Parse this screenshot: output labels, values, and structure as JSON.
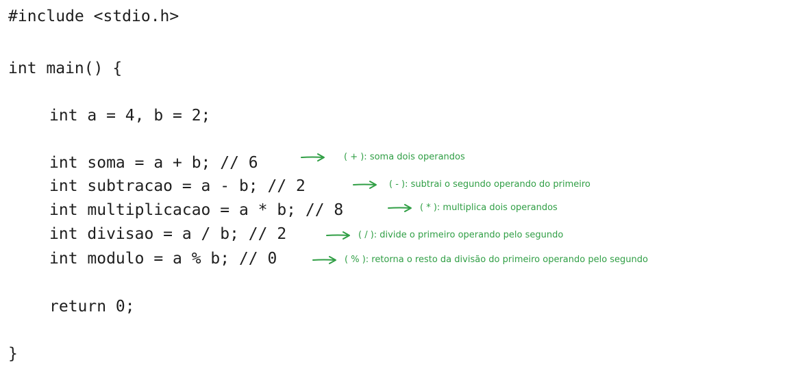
{
  "code": {
    "include": "#include <stdio.h>",
    "main_open": "int main() {",
    "decl": "int a = 4, b = 2;",
    "ops": [
      {
        "code": "int soma = a + b; // 6",
        "note": "( + ): soma dois operandos"
      },
      {
        "code": "int subtracao = a - b; // 2",
        "note": "( - ): subtrai o segundo operando do primeiro"
      },
      {
        "code": "int multiplicacao = a * b; // 8",
        "note": "( * ): multiplica dois operandos"
      },
      {
        "code": "int divisao = a / b; // 2",
        "note": "( / ): divide o primeiro operando pelo segundo"
      },
      {
        "code": "int modulo = a % b; // 0",
        "note": "( % ): retorna o resto da divisão do primeiro operando pelo segundo"
      }
    ],
    "return_stmt": "return 0;",
    "main_close": "}"
  },
  "colors": {
    "code_text": "#1e1e1e",
    "annotation": "#2f9e44",
    "background": "#ffffff"
  }
}
